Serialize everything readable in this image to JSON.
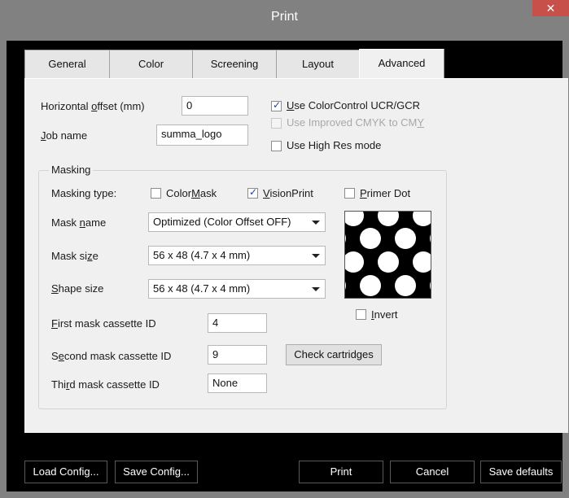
{
  "window": {
    "title": "Print",
    "close_glyph": "✕"
  },
  "tabs": [
    {
      "label": "General"
    },
    {
      "label": "Color"
    },
    {
      "label": "Screening"
    },
    {
      "label": "Layout"
    },
    {
      "label": "Advanced"
    }
  ],
  "active_tab": "Advanced",
  "advanced": {
    "horizontal_offset": {
      "label_pre": "Horizontal ",
      "label_u": "o",
      "label_post": "ffset (mm)",
      "value": "0"
    },
    "job_name": {
      "label_u": "J",
      "label_post": "ob name",
      "value": "summa_logo"
    },
    "use_colorcontrol": {
      "label_u": "U",
      "label_post": "se ColorControl UCR/GCR",
      "checked": true
    },
    "use_improved_cmyk": {
      "label_pre": "Use Improved CMYK to CM",
      "label_u": "Y",
      "checked": false,
      "enabled": false
    },
    "use_high_res": {
      "label": "Use High Res mode",
      "checked": false
    }
  },
  "masking": {
    "legend": "Masking",
    "masking_type_label": "Masking type:",
    "colormask": {
      "label_pre": "Color",
      "label_u": "M",
      "label_post": "ask",
      "checked": false
    },
    "visionprint": {
      "label_u": "V",
      "label_post": "isionPrint",
      "checked": true
    },
    "primer_dot": {
      "label_u": "P",
      "label_post": "rimer Dot",
      "checked": false
    },
    "mask_name": {
      "label_pre": "Mask ",
      "label_u": "n",
      "label_post": "ame",
      "value": "Optimized (Color Offset OFF)"
    },
    "mask_size": {
      "label_pre": "Mask si",
      "label_u": "z",
      "label_post": "e",
      "value": "56 x 48 (4.7 x 4 mm)"
    },
    "shape_size": {
      "label_u": "S",
      "label_post": "hape size",
      "value": "56 x 48 (4.7 x 4 mm)"
    },
    "invert": {
      "label_u": "I",
      "label_post": "nvert",
      "checked": false
    },
    "first_cassette": {
      "label_u": "F",
      "label_post": "irst mask cassette ID",
      "value": "4"
    },
    "second_cassette": {
      "label_pre": "S",
      "label_u": "e",
      "label_post": "cond mask cassette ID",
      "value": "9"
    },
    "third_cassette": {
      "label_pre": "Thi",
      "label_u": "r",
      "label_post": "d mask cassette ID",
      "value": "None"
    },
    "check_cartridges": "Check cartridges"
  },
  "footer": {
    "load_config": "Load Config...",
    "save_config": "Save Config...",
    "print": "Print",
    "cancel": "Cancel",
    "save_defaults": "Save defaults"
  }
}
